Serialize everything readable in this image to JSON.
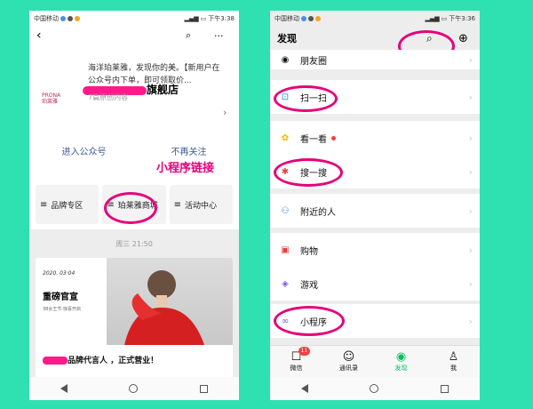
{
  "left": {
    "status": {
      "carrier": "中国移动",
      "time": "下午3:38"
    },
    "account": {
      "logo_text": "PRONA 珀莱雅",
      "name": "旗舰店",
      "desc": "海洋珀莱雅，发现你的美。【新用户在公众号内下单，即可领取价...",
      "articles": "7篇原创内容"
    },
    "actions": {
      "enter": "进入公众号",
      "unfollow": "不再关注"
    },
    "annotation": "小程序链接",
    "menu": [
      "品牌专区",
      "珀莱雅商城",
      "活动中心"
    ],
    "feed": {
      "time": "周三 21:50",
      "date": "2020. 03·04",
      "headline": "重磅官宣",
      "sub": "38女王节·惊喜开启",
      "title": "品牌代言人     ，正式营业！"
    }
  },
  "right": {
    "status": {
      "carrier": "中国移动",
      "time": "下午3:36"
    },
    "title": "发现",
    "cells": [
      "朋友圈",
      "扫一扫",
      "看一看",
      "搜一搜",
      "附近的人",
      "购物",
      "游戏",
      "小程序"
    ],
    "tabs": [
      {
        "label": "微信",
        "badge": "11"
      },
      {
        "label": "通讯录"
      },
      {
        "label": "发现"
      },
      {
        "label": "我"
      }
    ],
    "colors": {
      "accent": "#07c160",
      "annotation": "#e6007a"
    }
  }
}
